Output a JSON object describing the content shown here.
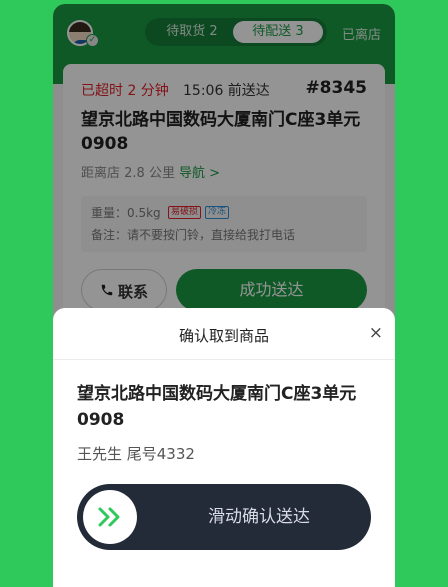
{
  "header": {
    "tabs": [
      {
        "label": "待取货 2"
      },
      {
        "label": "待配送 3"
      }
    ],
    "store_status": "已离店"
  },
  "order": {
    "overdue": "已超时 2 分钟",
    "deliver_by": "15:06 前送达",
    "order_no": "#8345",
    "address": "望京北路中国数码大厦南门C座3单元0908",
    "distance": "距离店 2.8 公里",
    "navigate": "导航 >",
    "weight": "重量：0.5kg",
    "tags": [
      "易破损",
      "冷冻"
    ],
    "remark": "备注：请不要按门铃，直接给我打电话",
    "contact_label": "联系",
    "success_label": "成功送达"
  },
  "sheet": {
    "title": "确认取到商品",
    "close": "×",
    "address": "望京北路中国数码大厦南门C座3单元0908",
    "customer": "王先生 尾号4332",
    "slider_label": "滑动确认送达"
  },
  "icons": [
    "avatar",
    "verified-icon",
    "phone-icon",
    "close-icon",
    "double-chevron-right-icon"
  ],
  "colors": {
    "brand_green": "#1b9a44",
    "alert_red": "#e0242b",
    "slider_dark": "#232a38"
  }
}
